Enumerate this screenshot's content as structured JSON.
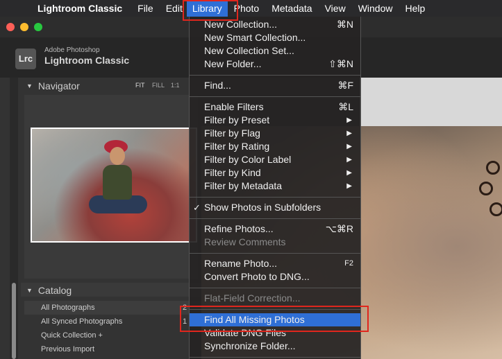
{
  "menubar": {
    "app_name": "Lightroom Classic",
    "items": [
      "File",
      "Edit",
      "Library",
      "Photo",
      "Metadata",
      "View",
      "Window",
      "Help"
    ],
    "active": "Library"
  },
  "identity": {
    "badge": "Lrc",
    "subtitle": "Adobe Photoshop",
    "title": "Lightroom Classic"
  },
  "navigator": {
    "title": "Navigator",
    "zoom": [
      "FIT",
      "FILL",
      "1:1"
    ]
  },
  "catalog": {
    "title": "Catalog",
    "items": [
      {
        "label": "All Photographs",
        "count": "2"
      },
      {
        "label": "All Synced Photographs",
        "count": "1"
      },
      {
        "label": "Quick Collection +",
        "count": ""
      },
      {
        "label": "Previous Import",
        "count": ""
      }
    ]
  },
  "library_menu": {
    "items": [
      {
        "label": "New Collection...",
        "shortcut": "⌘N"
      },
      {
        "label": "New Smart Collection...",
        "shortcut": ""
      },
      {
        "label": "New Collection Set...",
        "shortcut": ""
      },
      {
        "label": "New Folder...",
        "shortcut": "⇧⌘N"
      },
      {
        "label": "Find...",
        "shortcut": "⌘F"
      },
      {
        "label": "Enable Filters",
        "shortcut": "⌘L"
      },
      {
        "label": "Filter by Preset",
        "shortcut": "▶"
      },
      {
        "label": "Filter by Flag",
        "shortcut": "▶"
      },
      {
        "label": "Filter by Rating",
        "shortcut": "▶"
      },
      {
        "label": "Filter by Color Label",
        "shortcut": "▶"
      },
      {
        "label": "Filter by Kind",
        "shortcut": "▶"
      },
      {
        "label": "Filter by Metadata",
        "shortcut": "▶"
      },
      {
        "label": "Show Photos in Subfolders",
        "shortcut": "",
        "check": "✓"
      },
      {
        "label": "Refine Photos...",
        "shortcut": "⌥⌘R"
      },
      {
        "label": "Review Comments",
        "shortcut": ""
      },
      {
        "label": "Rename Photo...",
        "shortcut": "F2"
      },
      {
        "label": "Convert Photo to DNG...",
        "shortcut": ""
      },
      {
        "label": "Flat-Field Correction...",
        "shortcut": ""
      },
      {
        "label": "Find All Missing Photos",
        "shortcut": ""
      },
      {
        "label": "Validate DNG Files",
        "shortcut": ""
      },
      {
        "label": "Synchronize Folder...",
        "shortcut": ""
      }
    ]
  },
  "colors": {
    "highlight": "#2f6fd6",
    "annotation": "#e0261d",
    "menubar": "#2a2a2c"
  }
}
